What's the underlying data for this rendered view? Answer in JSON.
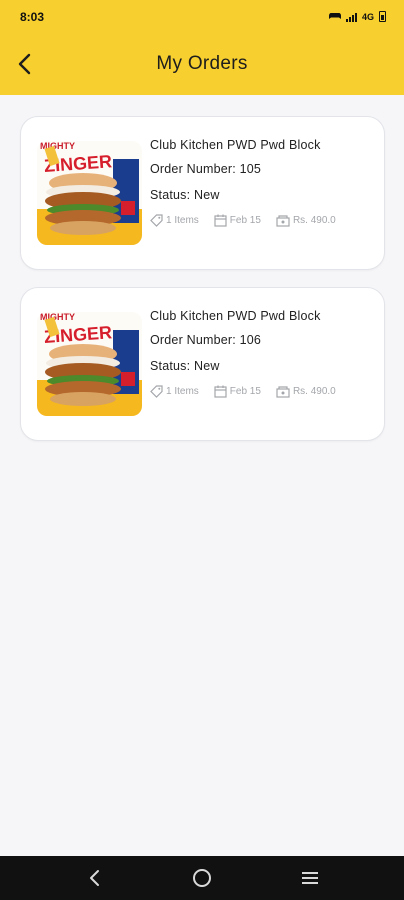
{
  "status_bar": {
    "time": "8:03",
    "network": "4G",
    "indicators": [
      "game-controller-icon",
      "signal-icon",
      "battery-icon"
    ]
  },
  "header": {
    "title": "My Orders",
    "back_icon": "chevron-left-icon",
    "background": "#f7cf2e"
  },
  "orders": [
    {
      "image_title": "ZINGER",
      "image_caption": "MIGHTY",
      "store_name": "Club Kitchen PWD Pwd Block",
      "order_number": "Order Number: 105",
      "status": "Status: New",
      "items": "1 Items",
      "date": "Feb 15",
      "total": "Rs. 490.0"
    },
    {
      "image_title": "ZINGER",
      "image_caption": "MIGHTY",
      "store_name": "Club Kitchen PWD Pwd Block",
      "order_number": "Order Number: 106",
      "status": "Status: New",
      "items": "1 Items",
      "date": "Feb 15",
      "total": "Rs. 490.0"
    }
  ],
  "nav": {
    "back": "back-triangle-icon",
    "home": "home-circle-icon",
    "menu": "menu-lines-icon"
  }
}
